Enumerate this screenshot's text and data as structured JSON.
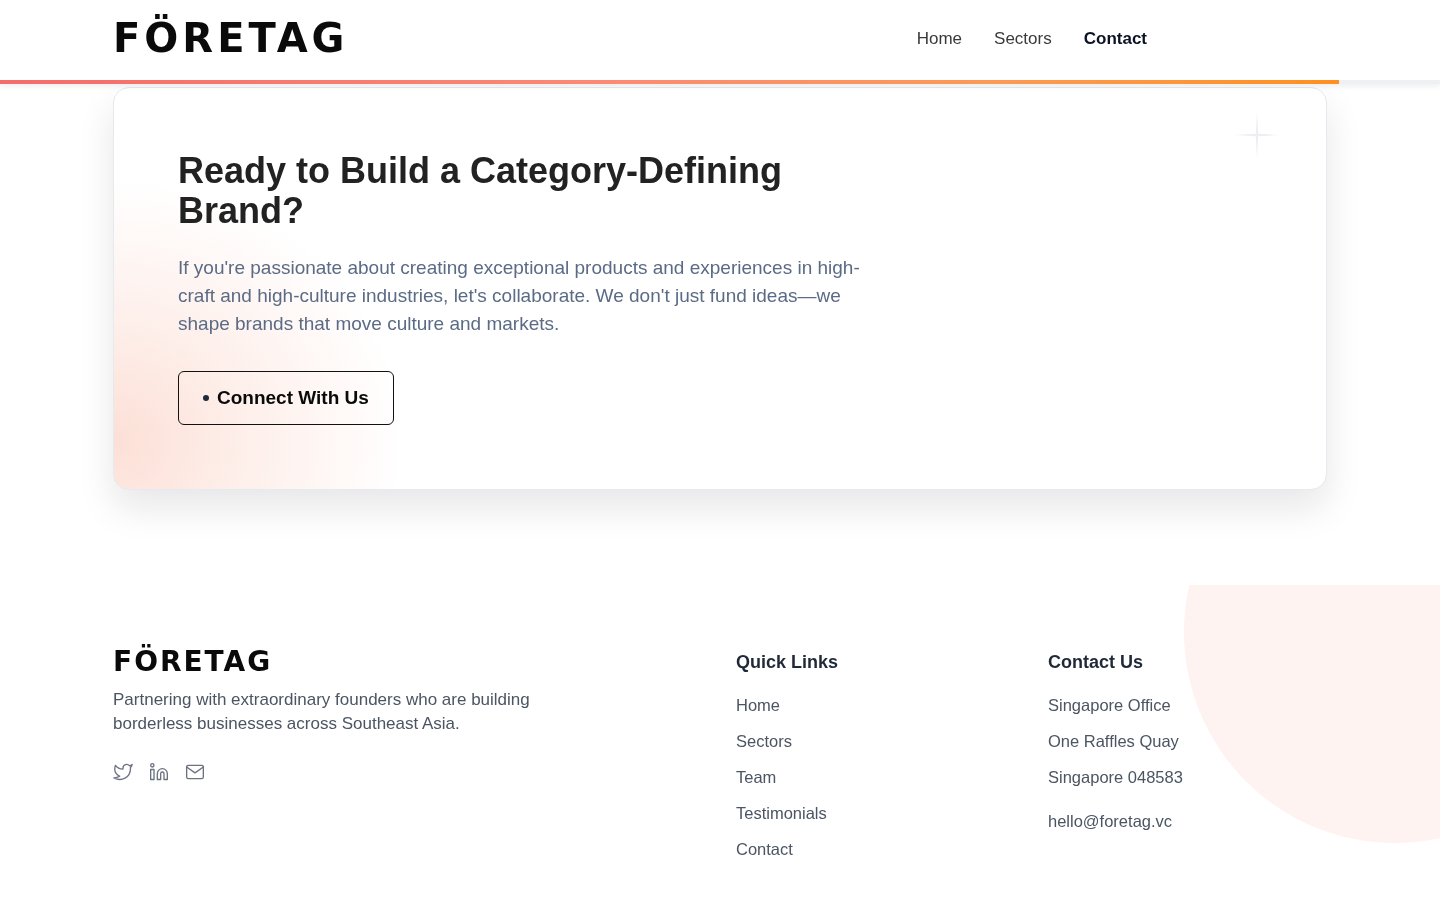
{
  "header": {
    "logo": "FÖRETAG",
    "nav": [
      {
        "label": "Home",
        "selected": false
      },
      {
        "label": "Sectors",
        "selected": false
      },
      {
        "label": "Contact",
        "selected": true
      }
    ],
    "scroll_progress": {
      "level": 0.93
    }
  },
  "cta": {
    "title": "Ready to Build a Category-Defining Brand?",
    "text": "If you're passionate about creating exceptional products and experiences in high-craft and high-culture industries, let's collaborate. We don't just fund ideas—we shape brands that move culture and markets.",
    "button": "Connect With Us"
  },
  "footer": {
    "logo": "FÖRETAG",
    "tagline": "Partnering with extraordinary founders who are building borderless businesses across Southeast Asia.",
    "social_links": [
      {
        "kind": "twitter"
      },
      {
        "kind": "linkedin"
      },
      {
        "kind": "email"
      }
    ],
    "quick_links": {
      "heading": "Quick Links",
      "items": [
        "Home",
        "Sectors",
        "Team",
        "Testimonials",
        "Contact"
      ]
    },
    "contact": {
      "heading": "Contact Us",
      "lines": [
        "Singapore Office",
        "One Raffles Quay",
        "Singapore 048583"
      ],
      "email": "hello@foretag.vc"
    }
  }
}
